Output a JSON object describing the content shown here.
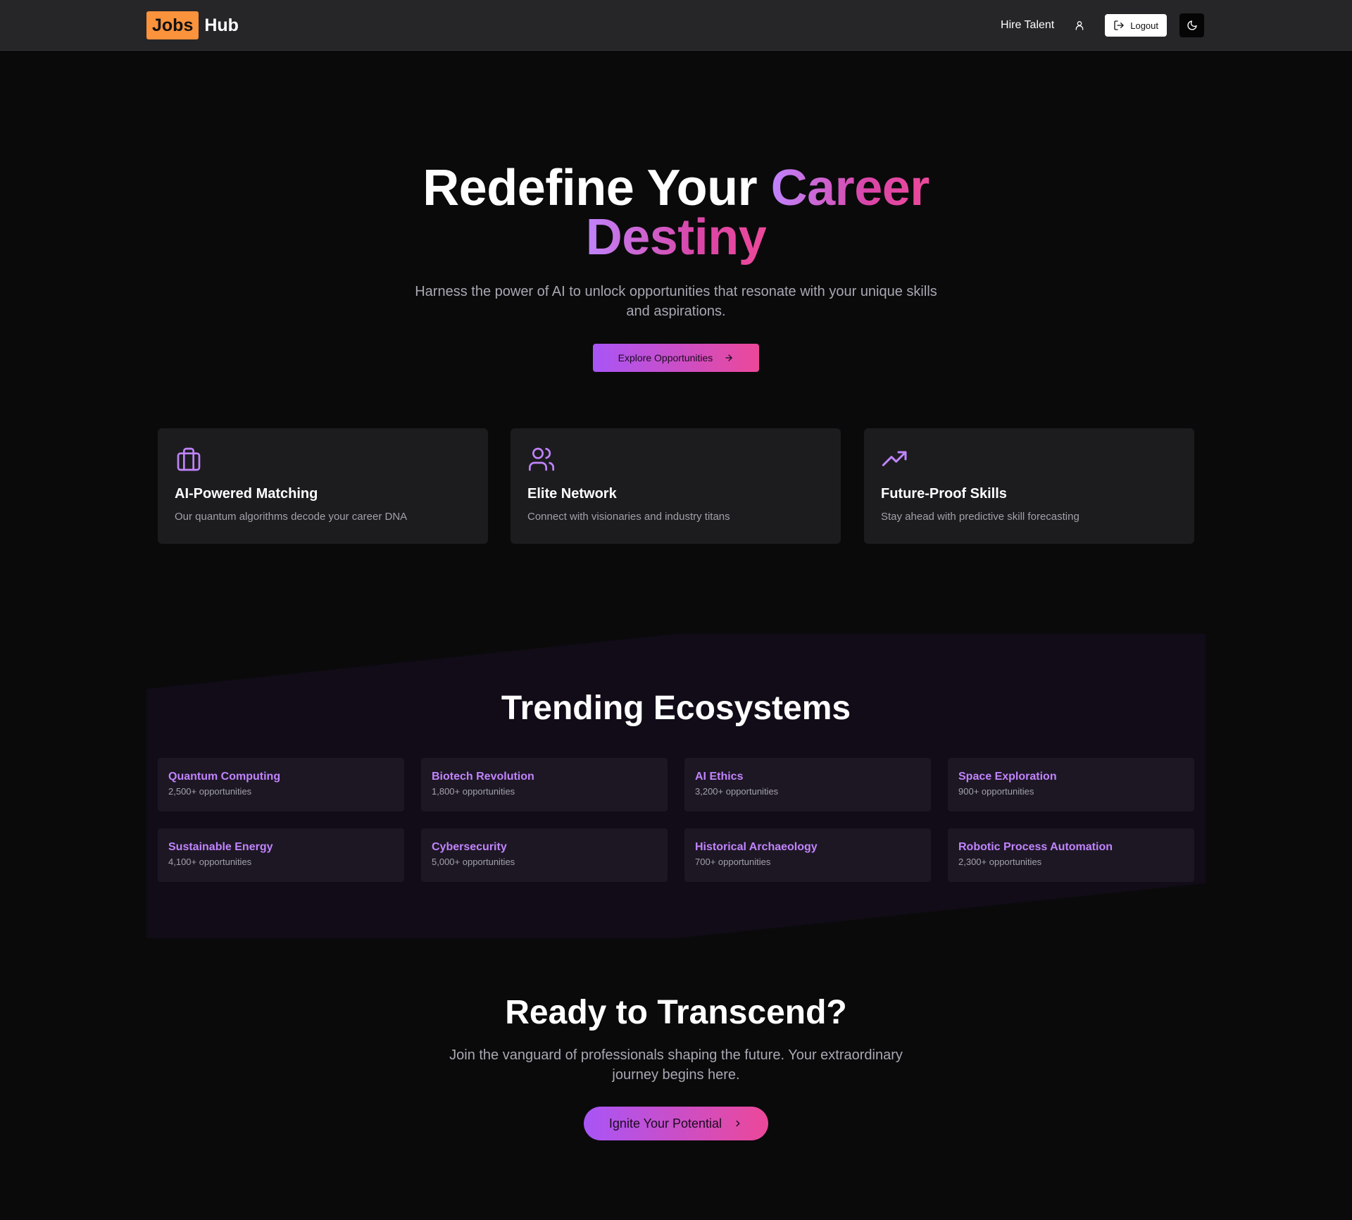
{
  "header": {
    "logo_primary": "Jobs",
    "logo_secondary": "Hub",
    "hire_talent": "Hire Talent",
    "logout": "Logout"
  },
  "hero": {
    "title_part1": "Redefine Your",
    "title_part2": "Career",
    "title_part3": "Destiny",
    "subtitle": "Harness the power of AI to unlock opportunities that resonate with your unique skills and aspirations.",
    "cta": "Explore Opportunities"
  },
  "features": [
    {
      "icon": "briefcase-icon",
      "title": "AI-Powered Matching",
      "description": "Our quantum algorithms decode your career DNA"
    },
    {
      "icon": "users-icon",
      "title": "Elite Network",
      "description": "Connect with visionaries and industry titans"
    },
    {
      "icon": "trending-up-icon",
      "title": "Future-Proof Skills",
      "description": "Stay ahead with predictive skill forecasting"
    }
  ],
  "trending": {
    "title": "Trending Ecosystems",
    "items": [
      {
        "name": "Quantum Computing",
        "count": "2,500+ opportunities"
      },
      {
        "name": "Biotech Revolution",
        "count": "1,800+ opportunities"
      },
      {
        "name": "AI Ethics",
        "count": "3,200+ opportunities"
      },
      {
        "name": "Space Exploration",
        "count": "900+ opportunities"
      },
      {
        "name": "Sustainable Energy",
        "count": "4,100+ opportunities"
      },
      {
        "name": "Cybersecurity",
        "count": "5,000+ opportunities"
      },
      {
        "name": "Historical Archaeology",
        "count": "700+ opportunities"
      },
      {
        "name": "Robotic Process Automation",
        "count": "2,300+ opportunities"
      }
    ]
  },
  "cta_section": {
    "title": "Ready to Transcend?",
    "subtitle": "Join the vanguard of professionals shaping the future. Your extraordinary journey begins here.",
    "button": "Ignite Your Potential"
  },
  "colors": {
    "background": "#0a0a0b",
    "header": "#262628",
    "accent_orange": "#fb923c",
    "accent_purple": "#a855f7",
    "accent_pink": "#ec4899",
    "card": "#1c1c1e",
    "eco_card": "#1d1724"
  }
}
